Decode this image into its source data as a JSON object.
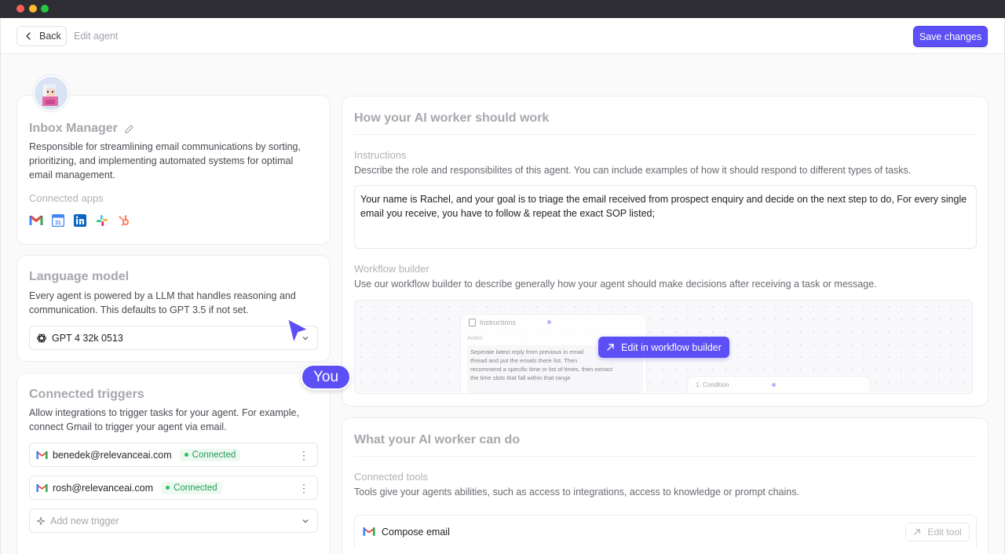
{
  "topbar": {
    "back_label": "Back",
    "breadcrumb": "Edit agent",
    "save_label": "Save changes"
  },
  "agent": {
    "name": "Inbox Manager",
    "description": "Responsible for streamlining email communications by sorting, prioritizing, and implementing automated systems for optimal email management.",
    "connected_apps_label": "Connected apps",
    "apps": [
      "gmail-icon",
      "google-calendar-icon",
      "linkedin-icon",
      "slack-icon",
      "hubspot-icon"
    ]
  },
  "language_model": {
    "title": "Language model",
    "description": "Every agent is powered by a LLM that handles reasoning and communication. This defaults to GPT 3.5 if not set.",
    "selected": "GPT 4 32k 0513"
  },
  "triggers": {
    "title": "Connected triggers",
    "description": "Allow integrations to trigger tasks for your agent. For example, connect Gmail to trigger your agent via email.",
    "items": [
      {
        "email": "benedek@relevanceai.com",
        "status": "Connected"
      },
      {
        "email": "rosh@relevanceai.com",
        "status": "Connected"
      }
    ],
    "add_placeholder": "Add new trigger"
  },
  "cursor_label": "You",
  "how_it_works": {
    "title": "How your AI worker should work",
    "instructions_label": "Instructions",
    "instructions_help": "Describe the role and responsibilites of this agent. You can include examples of how it should respond to different types of tasks.",
    "instructions_value": "Your name is Rachel, and your goal is to triage the email received from prospect enquiry and decide on the next step to do, For every single email you receive, you have to follow & repeat the exact SOP listed;",
    "workflow_label": "Workflow builder",
    "workflow_help": "Use our workflow builder to describe generally how your agent should make decisions after receiving a task or message.",
    "workflow_button": "Edit in workflow builder",
    "preview": {
      "node_title": "Instructions",
      "node_section": "Action",
      "node_text_1": "Seperate latest reply from previous in email",
      "node_text_2": "thread and put the emails there list. Then",
      "node_text_3": "recommend a specific time or list of times, then extract",
      "node_text_4": "the time slots that fall within that range",
      "condition_label": "1. Condition"
    }
  },
  "can_do": {
    "title": "What your AI worker can do",
    "tools_label": "Connected tools",
    "tools_help": "Tools give your agents abilities, such as access to integrations, access to knowledge or prompt chains.",
    "tools": [
      {
        "name": "Compose email",
        "action": "Edit tool"
      }
    ]
  },
  "colors": {
    "accent": "#5b4ff5",
    "connected": "#1f9d55"
  }
}
